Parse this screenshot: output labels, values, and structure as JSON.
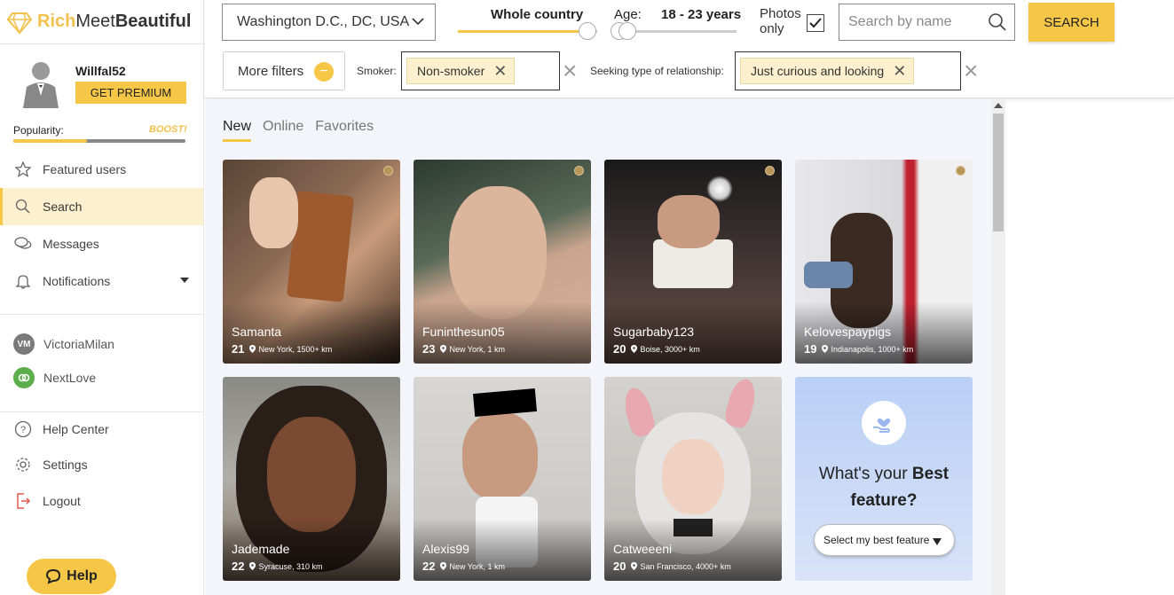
{
  "logo": {
    "rich": "Rich",
    "meet": "Meet",
    "beautiful": "Beautiful"
  },
  "profile": {
    "username": "Willfal52",
    "premium_label": "GET PREMIUM",
    "popularity_label": "Popularity:",
    "boost_label": "BOOST!",
    "popularity_level": 0.43
  },
  "nav": {
    "items": [
      {
        "label": "Featured users",
        "icon": "star-icon"
      },
      {
        "label": "Search",
        "icon": "search-icon"
      },
      {
        "label": "Messages",
        "icon": "chat-icon"
      },
      {
        "label": "Notifications",
        "icon": "bell-icon"
      }
    ],
    "partners": [
      {
        "label": "VictoriaMilan",
        "badge": "VM",
        "color": "#7a7a7a"
      },
      {
        "label": "NextLove",
        "color": "#5cae4c"
      }
    ],
    "footer": [
      {
        "label": "Help Center",
        "icon": "question-icon"
      },
      {
        "label": "Settings",
        "icon": "gear-icon"
      },
      {
        "label": "Logout",
        "icon": "logout-icon"
      }
    ],
    "help_label": "Help"
  },
  "header": {
    "location": "Washington D.C., DC, USA",
    "distance_label": "Whole country",
    "age_label": "Age:",
    "age_value": "18 - 23 years",
    "photos_label_1": "Photos",
    "photos_label_2": "only",
    "photos_checked": true,
    "search_placeholder": "Search by name",
    "search_button": "SEARCH",
    "more_filters": "More filters",
    "smoker_label": "Smoker:",
    "smoker_value": "Non-smoker",
    "relationship_label": "Seeking type of relationship:",
    "relationship_value": "Just curious and looking"
  },
  "tabs": [
    {
      "label": "New",
      "active": true
    },
    {
      "label": "Online",
      "active": false
    },
    {
      "label": "Favorites",
      "active": false
    }
  ],
  "profiles": [
    {
      "name": "Samanta",
      "age": "21",
      "location": "New York, 1500+ km"
    },
    {
      "name": "Funinthesun05",
      "age": "23",
      "location": "New York, 1 km"
    },
    {
      "name": "Sugarbaby123",
      "age": "20",
      "location": "Boise, 3000+ km"
    },
    {
      "name": "Kelovespaypigs",
      "age": "19",
      "location": "Indianapolis, 1000+ km"
    },
    {
      "name": "Jademade",
      "age": "22",
      "location": "Syracuse, 310 km"
    },
    {
      "name": "Alexis99",
      "age": "22",
      "location": "New York, 1 km"
    },
    {
      "name": "Catweeeni",
      "age": "20",
      "location": "San Francisco, 4000+ km"
    }
  ],
  "promo": {
    "line1": "What's your",
    "bold1": "Best",
    "bold2": "feature?",
    "select_label": "Select my best feature"
  },
  "colors": {
    "accent": "#f6c747",
    "accent_light": "#fdf0cf",
    "bg_main": "#f4f5fa"
  }
}
